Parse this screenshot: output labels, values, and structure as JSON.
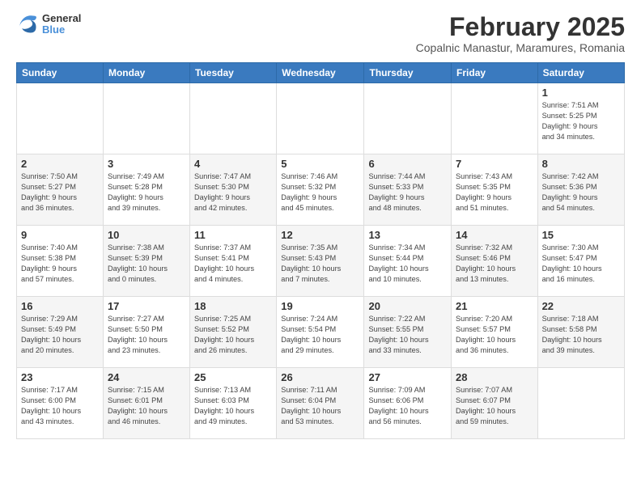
{
  "logo": {
    "line1": "General",
    "line2": "Blue"
  },
  "title": "February 2025",
  "subtitle": "Copalnic Manastur, Maramures, Romania",
  "weekdays": [
    "Sunday",
    "Monday",
    "Tuesday",
    "Wednesday",
    "Thursday",
    "Friday",
    "Saturday"
  ],
  "weeks": [
    [
      {
        "num": "",
        "info": "",
        "shaded": false,
        "empty": true
      },
      {
        "num": "",
        "info": "",
        "shaded": false,
        "empty": true
      },
      {
        "num": "",
        "info": "",
        "shaded": false,
        "empty": true
      },
      {
        "num": "",
        "info": "",
        "shaded": false,
        "empty": true
      },
      {
        "num": "",
        "info": "",
        "shaded": false,
        "empty": true
      },
      {
        "num": "",
        "info": "",
        "shaded": false,
        "empty": true
      },
      {
        "num": "1",
        "info": "Sunrise: 7:51 AM\nSunset: 5:25 PM\nDaylight: 9 hours\nand 34 minutes.",
        "shaded": false
      }
    ],
    [
      {
        "num": "2",
        "info": "Sunrise: 7:50 AM\nSunset: 5:27 PM\nDaylight: 9 hours\nand 36 minutes.",
        "shaded": true
      },
      {
        "num": "3",
        "info": "Sunrise: 7:49 AM\nSunset: 5:28 PM\nDaylight: 9 hours\nand 39 minutes.",
        "shaded": false
      },
      {
        "num": "4",
        "info": "Sunrise: 7:47 AM\nSunset: 5:30 PM\nDaylight: 9 hours\nand 42 minutes.",
        "shaded": true
      },
      {
        "num": "5",
        "info": "Sunrise: 7:46 AM\nSunset: 5:32 PM\nDaylight: 9 hours\nand 45 minutes.",
        "shaded": false
      },
      {
        "num": "6",
        "info": "Sunrise: 7:44 AM\nSunset: 5:33 PM\nDaylight: 9 hours\nand 48 minutes.",
        "shaded": true
      },
      {
        "num": "7",
        "info": "Sunrise: 7:43 AM\nSunset: 5:35 PM\nDaylight: 9 hours\nand 51 minutes.",
        "shaded": false
      },
      {
        "num": "8",
        "info": "Sunrise: 7:42 AM\nSunset: 5:36 PM\nDaylight: 9 hours\nand 54 minutes.",
        "shaded": true
      }
    ],
    [
      {
        "num": "9",
        "info": "Sunrise: 7:40 AM\nSunset: 5:38 PM\nDaylight: 9 hours\nand 57 minutes.",
        "shaded": false
      },
      {
        "num": "10",
        "info": "Sunrise: 7:38 AM\nSunset: 5:39 PM\nDaylight: 10 hours\nand 0 minutes.",
        "shaded": true
      },
      {
        "num": "11",
        "info": "Sunrise: 7:37 AM\nSunset: 5:41 PM\nDaylight: 10 hours\nand 4 minutes.",
        "shaded": false
      },
      {
        "num": "12",
        "info": "Sunrise: 7:35 AM\nSunset: 5:43 PM\nDaylight: 10 hours\nand 7 minutes.",
        "shaded": true
      },
      {
        "num": "13",
        "info": "Sunrise: 7:34 AM\nSunset: 5:44 PM\nDaylight: 10 hours\nand 10 minutes.",
        "shaded": false
      },
      {
        "num": "14",
        "info": "Sunrise: 7:32 AM\nSunset: 5:46 PM\nDaylight: 10 hours\nand 13 minutes.",
        "shaded": true
      },
      {
        "num": "15",
        "info": "Sunrise: 7:30 AM\nSunset: 5:47 PM\nDaylight: 10 hours\nand 16 minutes.",
        "shaded": false
      }
    ],
    [
      {
        "num": "16",
        "info": "Sunrise: 7:29 AM\nSunset: 5:49 PM\nDaylight: 10 hours\nand 20 minutes.",
        "shaded": true
      },
      {
        "num": "17",
        "info": "Sunrise: 7:27 AM\nSunset: 5:50 PM\nDaylight: 10 hours\nand 23 minutes.",
        "shaded": false
      },
      {
        "num": "18",
        "info": "Sunrise: 7:25 AM\nSunset: 5:52 PM\nDaylight: 10 hours\nand 26 minutes.",
        "shaded": true
      },
      {
        "num": "19",
        "info": "Sunrise: 7:24 AM\nSunset: 5:54 PM\nDaylight: 10 hours\nand 29 minutes.",
        "shaded": false
      },
      {
        "num": "20",
        "info": "Sunrise: 7:22 AM\nSunset: 5:55 PM\nDaylight: 10 hours\nand 33 minutes.",
        "shaded": true
      },
      {
        "num": "21",
        "info": "Sunrise: 7:20 AM\nSunset: 5:57 PM\nDaylight: 10 hours\nand 36 minutes.",
        "shaded": false
      },
      {
        "num": "22",
        "info": "Sunrise: 7:18 AM\nSunset: 5:58 PM\nDaylight: 10 hours\nand 39 minutes.",
        "shaded": true
      }
    ],
    [
      {
        "num": "23",
        "info": "Sunrise: 7:17 AM\nSunset: 6:00 PM\nDaylight: 10 hours\nand 43 minutes.",
        "shaded": false
      },
      {
        "num": "24",
        "info": "Sunrise: 7:15 AM\nSunset: 6:01 PM\nDaylight: 10 hours\nand 46 minutes.",
        "shaded": true
      },
      {
        "num": "25",
        "info": "Sunrise: 7:13 AM\nSunset: 6:03 PM\nDaylight: 10 hours\nand 49 minutes.",
        "shaded": false
      },
      {
        "num": "26",
        "info": "Sunrise: 7:11 AM\nSunset: 6:04 PM\nDaylight: 10 hours\nand 53 minutes.",
        "shaded": true
      },
      {
        "num": "27",
        "info": "Sunrise: 7:09 AM\nSunset: 6:06 PM\nDaylight: 10 hours\nand 56 minutes.",
        "shaded": false
      },
      {
        "num": "28",
        "info": "Sunrise: 7:07 AM\nSunset: 6:07 PM\nDaylight: 10 hours\nand 59 minutes.",
        "shaded": true
      },
      {
        "num": "",
        "info": "",
        "shaded": false,
        "empty": true
      }
    ]
  ]
}
